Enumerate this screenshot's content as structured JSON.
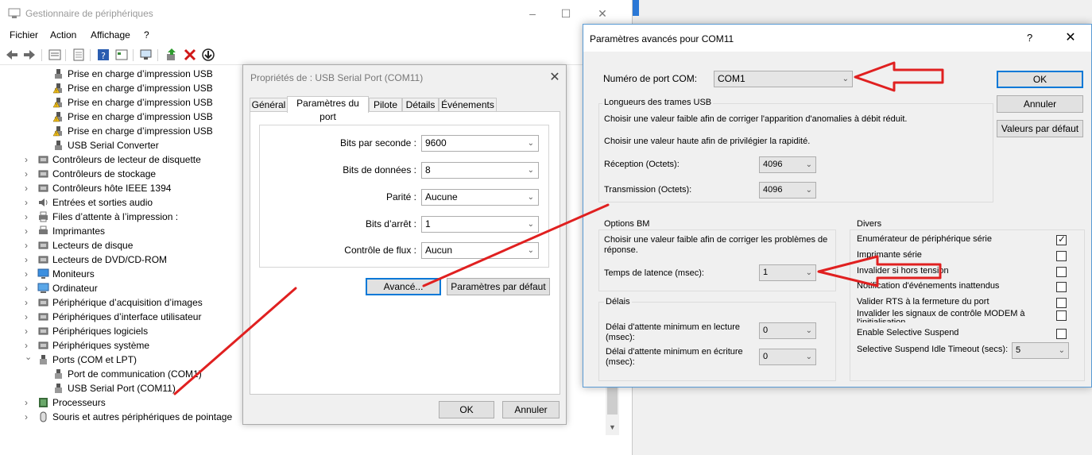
{
  "device_manager": {
    "title": "Gestionnaire de périphériques",
    "menu": [
      "Fichier",
      "Action",
      "Affichage",
      "?"
    ],
    "tree": [
      {
        "label": "Prise en charge d’impression USB",
        "indent": 2,
        "icon": "usb-plug-icon",
        "warn": false
      },
      {
        "label": "Prise en charge d’impression USB",
        "indent": 2,
        "icon": "usb-plug-warning-icon",
        "warn": true
      },
      {
        "label": "Prise en charge d’impression USB",
        "indent": 2,
        "icon": "usb-plug-warning-icon",
        "warn": true
      },
      {
        "label": "Prise en charge d’impression USB",
        "indent": 2,
        "icon": "usb-plug-warning-icon",
        "warn": true
      },
      {
        "label": "Prise en charge d’impression USB",
        "indent": 2,
        "icon": "usb-plug-warning-icon",
        "warn": true
      },
      {
        "label": "USB Serial Converter",
        "indent": 2,
        "icon": "usb-plug-icon",
        "warn": false
      },
      {
        "label": "Contrôleurs de lecteur de disquette",
        "indent": 1,
        "expander": "›",
        "icon": "floppy-controller-icon"
      },
      {
        "label": "Contrôleurs de stockage",
        "indent": 1,
        "expander": "›",
        "icon": "storage-controller-icon"
      },
      {
        "label": "Contrôleurs hôte IEEE 1394",
        "indent": 1,
        "expander": "›",
        "icon": "ieee1394-icon"
      },
      {
        "label": "Entrées et sorties audio",
        "indent": 1,
        "expander": "›",
        "icon": "audio-icon"
      },
      {
        "label": "Files d’attente à l’impression :",
        "indent": 1,
        "expander": "›",
        "icon": "print-queue-icon"
      },
      {
        "label": "Imprimantes",
        "indent": 1,
        "expander": "›",
        "icon": "printer-icon"
      },
      {
        "label": "Lecteurs de disque",
        "indent": 1,
        "expander": "›",
        "icon": "disk-drive-icon"
      },
      {
        "label": "Lecteurs de DVD/CD-ROM",
        "indent": 1,
        "expander": "›",
        "icon": "dvd-drive-icon"
      },
      {
        "label": "Moniteurs",
        "indent": 1,
        "expander": "›",
        "icon": "monitor-icon"
      },
      {
        "label": "Ordinateur",
        "indent": 1,
        "expander": "›",
        "icon": "computer-icon"
      },
      {
        "label": "Périphérique d’acquisition d’images",
        "indent": 1,
        "expander": "›",
        "icon": "camera-icon"
      },
      {
        "label": "Périphériques d’interface utilisateur",
        "indent": 1,
        "expander": "›",
        "icon": "hid-icon"
      },
      {
        "label": "Périphériques logiciels",
        "indent": 1,
        "expander": "›",
        "icon": "software-device-icon"
      },
      {
        "label": "Périphériques système",
        "indent": 1,
        "expander": "›",
        "icon": "system-device-icon"
      },
      {
        "label": "Ports (COM et LPT)",
        "indent": 1,
        "expander": "⌄",
        "icon": "port-icon"
      },
      {
        "label": "Port de communication (COM1)",
        "indent": 2,
        "icon": "port-icon"
      },
      {
        "label": "USB Serial Port (COM11)",
        "indent": 2,
        "icon": "port-icon"
      },
      {
        "label": "Processeurs",
        "indent": 1,
        "expander": "›",
        "icon": "processor-icon"
      },
      {
        "label": "Souris et autres périphériques de pointage",
        "indent": 1,
        "expander": "›",
        "icon": "mouse-icon"
      }
    ]
  },
  "properties": {
    "title": "Propriétés de : USB Serial Port (COM11)",
    "tabs": [
      "Général",
      "Paramètres du port",
      "Pilote",
      "Détails",
      "Événements"
    ],
    "active_tab": "Paramètres du port",
    "fields": {
      "bits_per_second": {
        "label": "Bits par seconde :",
        "value": "9600"
      },
      "data_bits": {
        "label": "Bits de données :",
        "value": "8"
      },
      "parity": {
        "label": "Parité :",
        "value": "Aucune"
      },
      "stop_bits": {
        "label": "Bits d’arrêt :",
        "value": "1"
      },
      "flow_control": {
        "label": "Contrôle de flux :",
        "value": "Aucun"
      }
    },
    "advanced_button": "Avancé...",
    "defaults_button": "Paramètres par défaut",
    "ok_button": "OK",
    "cancel_button": "Annuler"
  },
  "advanced": {
    "title": "Paramètres avancés pour COM11",
    "help": "?",
    "com_port_label": "Numéro de port COM:",
    "com_port_value": "COM1",
    "ok_button": "OK",
    "cancel_button": "Annuler",
    "defaults_button": "Valeurs par défaut",
    "usb_group": {
      "title": "Longueurs des trames USB",
      "text1": "Choisir une valeur faible afin de corriger  l'apparition d'anomalies à débit réduit.",
      "text2": "Choisir une valeur haute afin de privilégier la rapidité.",
      "receive_label": "Réception (Octets):",
      "receive_value": "4096",
      "transmit_label": "Transmission (Octets):",
      "transmit_value": "4096"
    },
    "bm_group": {
      "title": "Options BM",
      "text": "Choisir une valeur faible afin de corriger les problèmes de réponse.",
      "latency_label": "Temps de latence (msec):",
      "latency_value": "1"
    },
    "delays_group": {
      "title": "Délais",
      "read_label": "Délai d'attente minimum en lecture (msec):",
      "read_value": "0",
      "write_label": "Délai d'attente minimum en écriture (msec):",
      "write_value": "0"
    },
    "misc_group": {
      "title": "Divers",
      "options": [
        {
          "label": "Enumérateur de périphérique série",
          "checked": true
        },
        {
          "label": "Imprimante série",
          "checked": false
        },
        {
          "label": "Invalider si hors tension",
          "checked": false
        },
        {
          "label": "Notification d'événements inattendus",
          "checked": false
        },
        {
          "label": "Valider RTS à la fermeture du port",
          "checked": false
        },
        {
          "label": "Invalider les signaux de contrôle MODEM à l'initialisation",
          "checked": false
        },
        {
          "label": "Enable Selective Suspend",
          "checked": false
        }
      ],
      "idle_timeout_label": "Selective Suspend Idle Timeout (secs):",
      "idle_timeout_value": "5"
    }
  },
  "annotation_color": "#e02020"
}
